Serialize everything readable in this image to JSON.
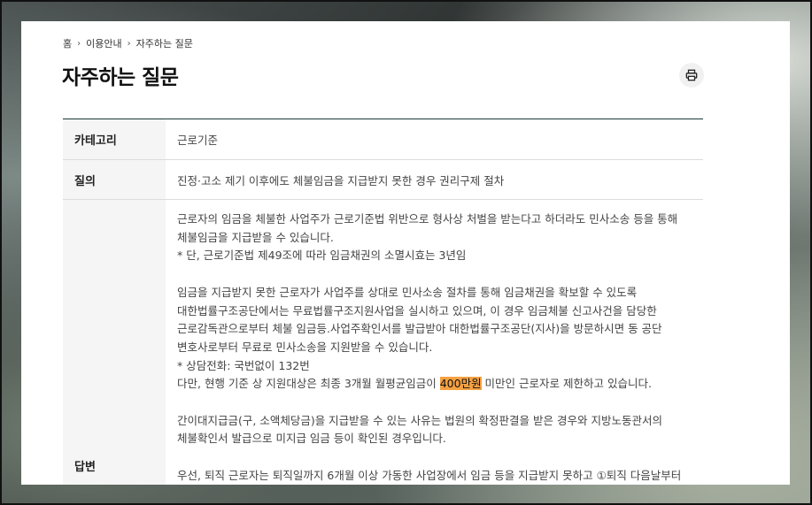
{
  "breadcrumb": {
    "items": [
      "홈",
      "이용안내",
      "자주하는 질문"
    ]
  },
  "page": {
    "title": "자주하는 질문"
  },
  "table": {
    "category_label": "카테고리",
    "category_value": "근로기준",
    "question_label": "질의",
    "question_value": "진정·고소 제기 이후에도 체불임금을 지급받지 못한 경우 권리구제 절차",
    "answer_label": "답변",
    "answer": {
      "p1_l1": "근로자의 임금을 체불한 사업주가 근로기준법 위반으로 형사상 처벌을 받는다고 하더라도 민사소송 등을 통해",
      "p1_l2": "체불임금을 지급받을 수 있습니다.",
      "p1_l3": "* 단, 근로기준법 제49조에 따라 임금채권의 소멸시효는 3년임",
      "p2_l1": "임금을 지급받지 못한 근로자가 사업주를 상대로 민사소송 절차를 통해 임금채권을 확보할 수 있도록",
      "p2_l2": "대한법률구조공단에서는 무료법률구조지원사업을 실시하고 있으며, 이 경우 임금체불 신고사건을 담당한",
      "p2_l3": "근로감독관으로부터 체불 임금등.사업주확인서를 발급받아 대한법률구조공단(지사)을 방문하시면 동 공단",
      "p2_l4": "변호사로부터 무료로 민사소송을 지원받을 수 있습니다.",
      "p2_l5": "* 상담전화: 국번없이 132번",
      "p2_l6_before": "다만, 현행 기준 상 지원대상은 최종 3개월 월평균임금이 ",
      "p2_l6_highlight": "400만원",
      "p2_l6_after": " 미만인 근로자로 제한하고 있습니다.",
      "p3_l1": "간이대지급금(구, 소액체당금)을 지급받을 수 있는 사유는 법원의 확정판결을 받은 경우와 지방노동관서의",
      "p3_l2": "체불확인서 발급으로 미지급 임금 등이 확인된 경우입니다.",
      "p4_l1": "우선, 퇴직 근로자는 퇴직일까지 6개월 이상 가동한 사업장에서 임금 등을 지급받지 못하고 ①퇴직 다음날부터"
    }
  },
  "colors": {
    "highlight": "#f5a142",
    "table_top_border": "#1c3a36"
  },
  "icons": {
    "print": "print-icon",
    "separator": "chevron-right-icon"
  }
}
